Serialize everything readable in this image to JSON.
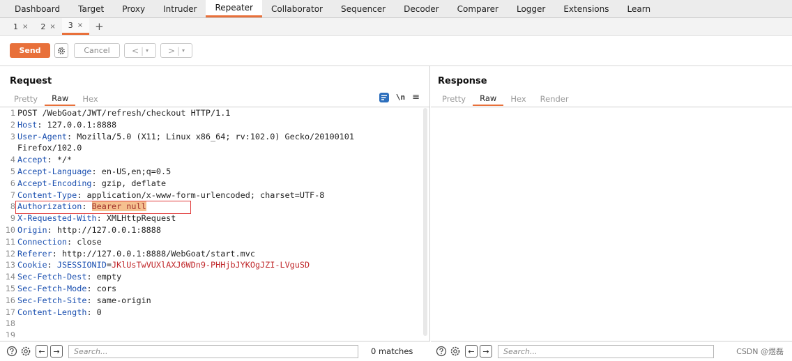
{
  "topnav": {
    "tabs": [
      "Dashboard",
      "Target",
      "Proxy",
      "Intruder",
      "Repeater",
      "Collaborator",
      "Sequencer",
      "Decoder",
      "Comparer",
      "Logger",
      "Extensions",
      "Learn"
    ],
    "active": "Repeater"
  },
  "subtabs": {
    "tabs": [
      {
        "label": "1",
        "close": "×"
      },
      {
        "label": "2",
        "close": "×"
      },
      {
        "label": "3",
        "close": "×"
      }
    ],
    "active_index": 2,
    "add": "+"
  },
  "toolbar": {
    "send_label": "Send",
    "cancel_label": "Cancel",
    "back_label": "<",
    "forward_label": ">",
    "dropdown_glyph": "▾",
    "gear_icon": "gear-icon"
  },
  "request": {
    "title": "Request",
    "view_tabs": [
      "Pretty",
      "Raw",
      "Hex"
    ],
    "active_view": "Raw",
    "ln_toggle": "\\n",
    "menu_glyph": "≡",
    "lines": [
      {
        "n": "1",
        "key": "",
        "val": "POST /WebGoat/JWT/refresh/checkout HTTP/1.1"
      },
      {
        "n": "2",
        "key": "Host",
        "val": "127.0.0.1:8888"
      },
      {
        "n": "3",
        "key": "User-Agent",
        "val": "Mozilla/5.0 (X11; Linux x86_64; rv:102.0) Gecko/20100101"
      },
      {
        "n": "",
        "key": "",
        "val": "Firefox/102.0"
      },
      {
        "n": "4",
        "key": "Accept",
        "val": "*/*"
      },
      {
        "n": "5",
        "key": "Accept-Language",
        "val": "en-US,en;q=0.5"
      },
      {
        "n": "6",
        "key": "Accept-Encoding",
        "val": "gzip, deflate"
      },
      {
        "n": "7",
        "key": "Content-Type",
        "val": "application/x-www-form-urlencoded; charset=UTF-8"
      },
      {
        "n": "8",
        "key": "Authorization",
        "val": "Bearer null",
        "highlight": true
      },
      {
        "n": "9",
        "key": "X-Requested-With",
        "val": "XMLHttpRequest"
      },
      {
        "n": "10",
        "key": "Origin",
        "val": "http://127.0.0.1:8888"
      },
      {
        "n": "11",
        "key": "Connection",
        "val": "close"
      },
      {
        "n": "12",
        "key": "Referer",
        "val": "http://127.0.0.1:8888/WebGoat/start.mvc"
      },
      {
        "n": "13",
        "key": "Cookie",
        "val": "",
        "cookie_name": "JSESSIONID",
        "cookie_value": "JKlUsTwVUXlAXJ6WDn9-PHHjbJYKOgJZI-LVguSD"
      },
      {
        "n": "14",
        "key": "Sec-Fetch-Dest",
        "val": "empty"
      },
      {
        "n": "15",
        "key": "Sec-Fetch-Mode",
        "val": "cors"
      },
      {
        "n": "16",
        "key": "Sec-Fetch-Site",
        "val": "same-origin"
      },
      {
        "n": "17",
        "key": "Content-Length",
        "val": "0"
      },
      {
        "n": "18",
        "key": "",
        "val": ""
      },
      {
        "n": "19",
        "key": "",
        "val": ""
      }
    ],
    "search_placeholder": "Search...",
    "matches": "0 matches"
  },
  "response": {
    "title": "Response",
    "view_tabs": [
      "Pretty",
      "Raw",
      "Hex",
      "Render"
    ],
    "active_view": "Raw",
    "search_placeholder": "Search..."
  },
  "watermark": "CSDN @煜磊",
  "colors": {
    "accent": "#e8703a",
    "header_key": "#1a4fb0",
    "cookie_value": "#c0282b",
    "highlight_bg": "#f5c08f",
    "annotation_box": "#e03a3a"
  }
}
